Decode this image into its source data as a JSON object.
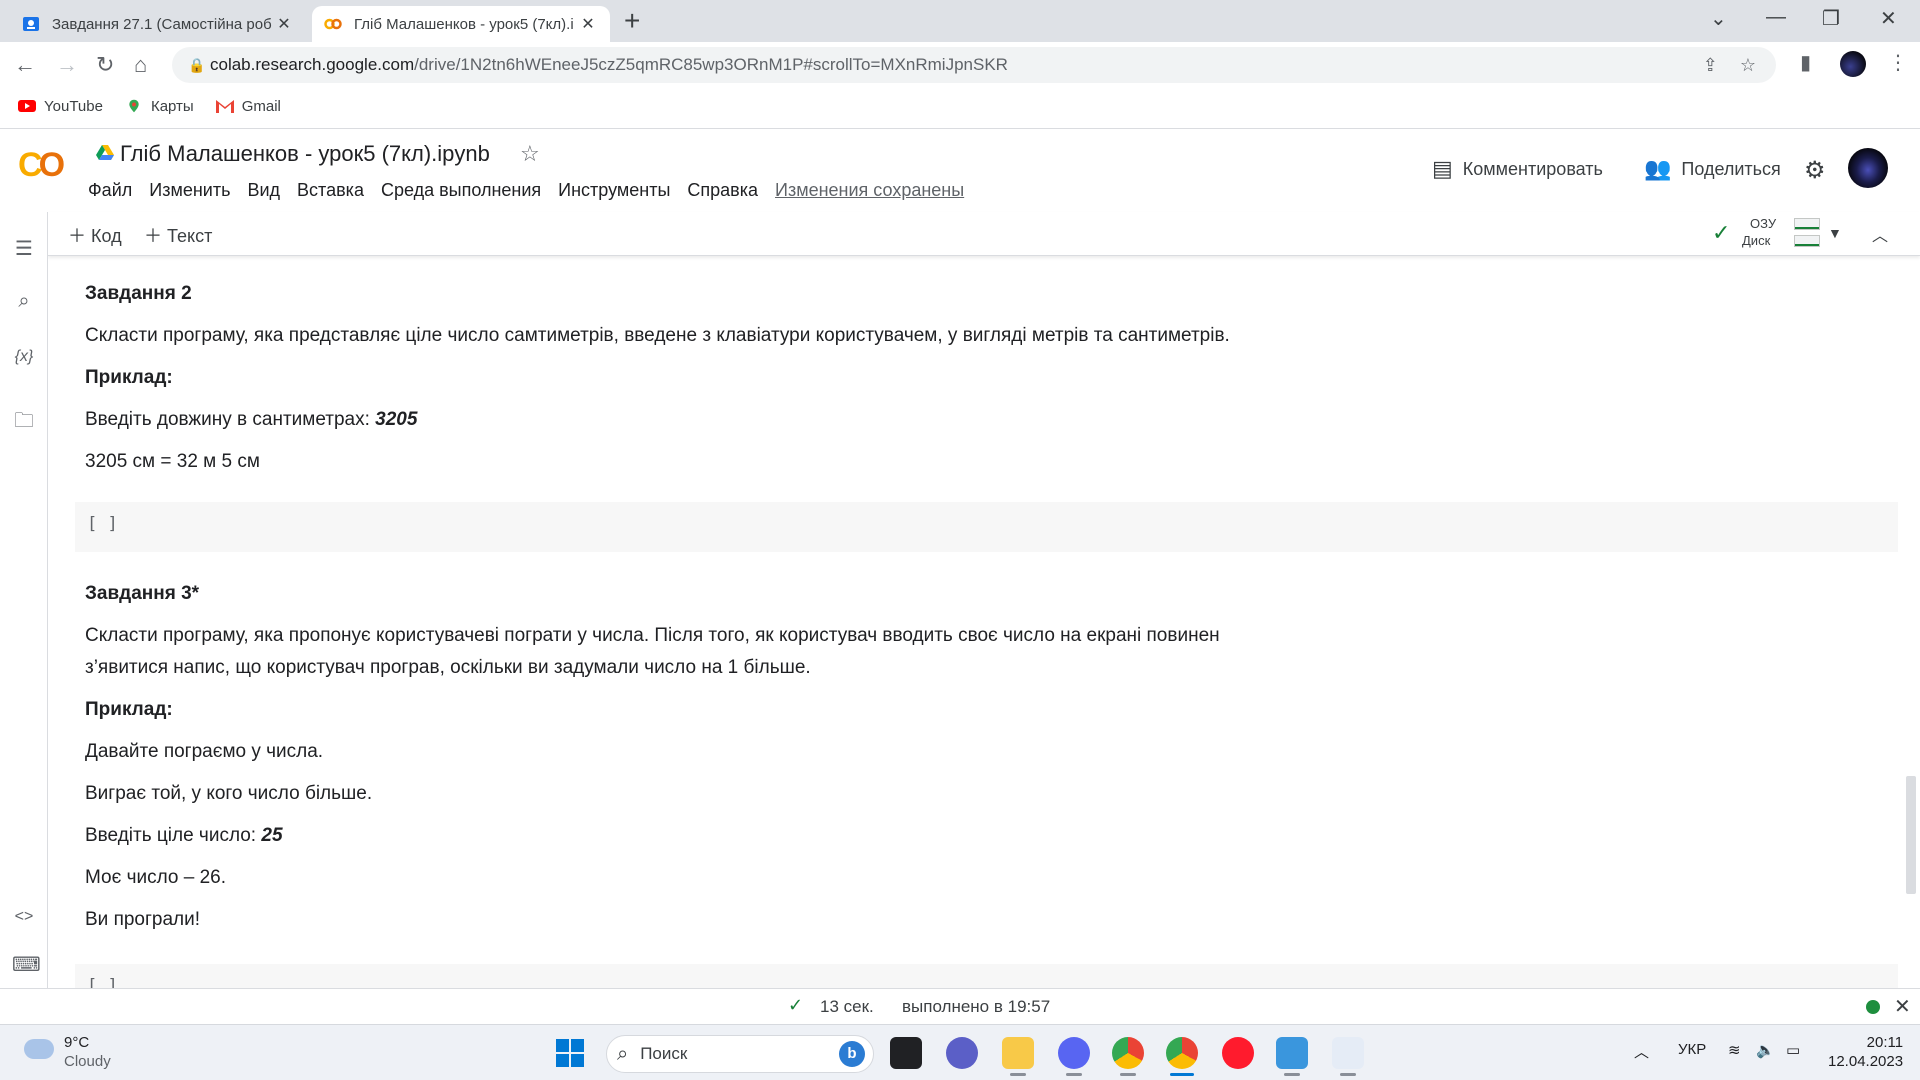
{
  "browser": {
    "tabs": [
      {
        "title": "Завдання 27.1 (Самостійна роб",
        "active": false
      },
      {
        "title": "Гліб Малашенков - урок5 (7кл).i",
        "active": true
      }
    ],
    "url_host": "colab.research.google.com",
    "url_path": "/drive/1N2tn6hWEneeJ5czZ5qmRC85wp3ORnM1P#scrollTo=MXnRmiJpnSKR",
    "bookmarks": [
      "YouTube",
      "Карты",
      "Gmail"
    ]
  },
  "colab": {
    "notebook_title": "Гліб Малашенков - урок5 (7кл).ipynb",
    "menu": [
      "Файл",
      "Изменить",
      "Вид",
      "Вставка",
      "Среда выполнения",
      "Инструменты",
      "Справка"
    ],
    "saved_status": "Изменения сохранены",
    "comment_label": "Комментировать",
    "share_label": "Поделиться",
    "add_code": "Код",
    "add_text": "Текст",
    "ram_label": "ОЗУ",
    "disk_label": "Диск"
  },
  "content": {
    "task2_heading": "Завдання 2",
    "task2_desc": "Скласти програму, яка представляє ціле число самтиметрів, введене з клавіатури користувачем, у вигляді метрів та сантиметрів.",
    "example_label": "Приклад:",
    "task2_prompt": "Введіть довжину в сантиметрах: ",
    "task2_input": "3205",
    "task2_result": "3205 см = 32 м 5 см",
    "cell_brackets": "[ ]",
    "task3_heading": "Завдання 3*",
    "task3_desc_1": "Скласти програму, яка пропонує користувачеві пограти у числа. Після того, як користувач вводить своє число на екрані повинен",
    "task3_desc_2": "з’явитися напис, що користувач програв, оскільки ви задумали число на 1 більше.",
    "task3_line1": "Давайте пограємо у числа.",
    "task3_line2": "Виграє той, у кого число більше.",
    "task3_prompt": "Введіть ціле число: ",
    "task3_input": "25",
    "task3_line4": "Моє число – 26.",
    "task3_line5": "Ви програли!"
  },
  "statusbar": {
    "duration": "13 сек.",
    "executed": "выполнено в 19:57"
  },
  "taskbar": {
    "temp": "9°C",
    "weather": "Cloudy",
    "search_placeholder": "Поиск",
    "lang": "УКР",
    "time": "20:11",
    "date": "12.04.2023"
  },
  "colors": {
    "colab_orange": "#f9ab00",
    "success_green": "#188038",
    "windows_blue": "#0078d4"
  }
}
